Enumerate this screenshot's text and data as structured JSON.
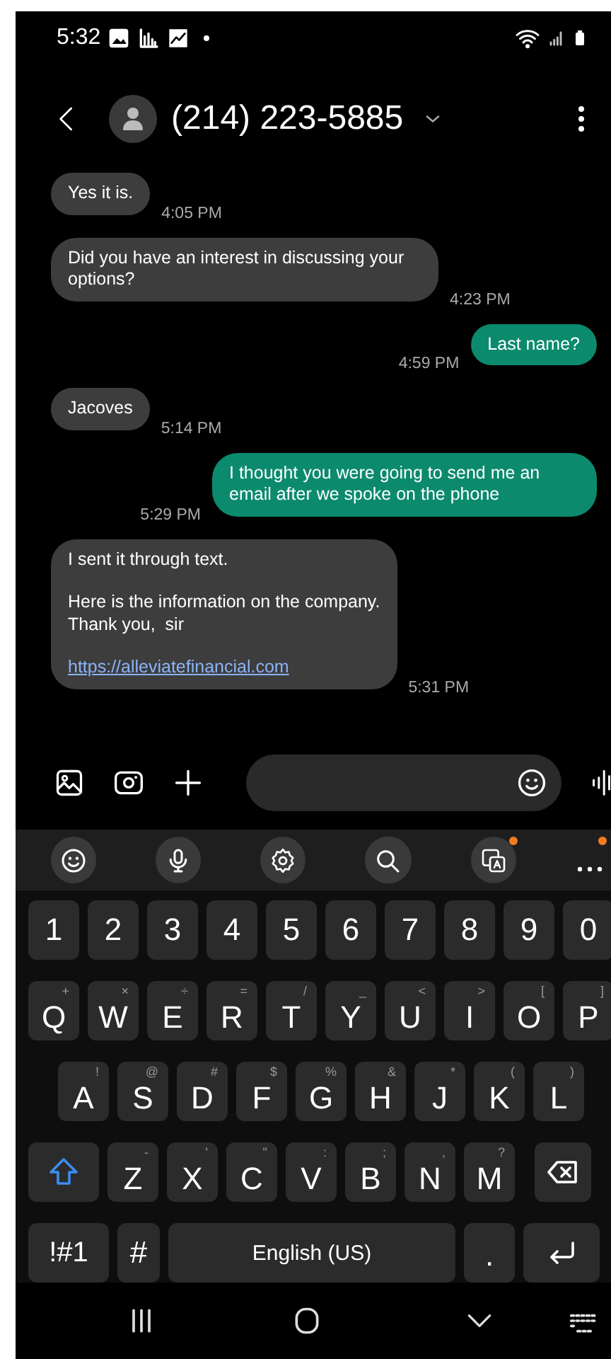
{
  "status_bar": {
    "time": "5:32"
  },
  "header": {
    "title": "(214) 223-5885"
  },
  "messages": [
    {
      "kind": "received",
      "paragraphs": [
        "Yes it is."
      ],
      "time": "4:05 PM"
    },
    {
      "kind": "received",
      "paragraphs": [
        "Did you have an interest in discussing your options?"
      ],
      "time": "4:23 PM"
    },
    {
      "kind": "sent",
      "paragraphs": [
        "Last name?"
      ],
      "time": "4:59 PM"
    },
    {
      "kind": "received",
      "paragraphs": [
        "Jacoves"
      ],
      "time": "5:14 PM"
    },
    {
      "kind": "sent",
      "paragraphs": [
        "I thought you were going to send me an email after we spoke on the phone"
      ],
      "time": "5:29 PM"
    },
    {
      "kind": "received",
      "paragraphs": [
        "I sent it through text.",
        "Here is the information on the company.\nThank you,  sir"
      ],
      "link": "https://alleviatefinancial.com",
      "time": "5:31 PM"
    }
  ],
  "keyboard": {
    "toolbar": [
      {
        "kind": "emoji",
        "badge": false
      },
      {
        "kind": "mic",
        "badge": false
      },
      {
        "kind": "settings",
        "badge": false
      },
      {
        "kind": "search",
        "badge": false
      },
      {
        "kind": "translate",
        "badge": true
      },
      {
        "kind": "more",
        "badge": true
      }
    ],
    "number_row": [
      {
        "kind": "char",
        "label": "1"
      },
      {
        "kind": "char",
        "label": "2"
      },
      {
        "kind": "char",
        "label": "3"
      },
      {
        "kind": "char",
        "label": "4"
      },
      {
        "kind": "char",
        "label": "5"
      },
      {
        "kind": "char",
        "label": "6"
      },
      {
        "kind": "char",
        "label": "7"
      },
      {
        "kind": "char",
        "label": "8"
      },
      {
        "kind": "char",
        "label": "9"
      },
      {
        "kind": "char",
        "label": "0"
      }
    ],
    "top_row": [
      {
        "kind": "char",
        "label": "Q",
        "hint": "+"
      },
      {
        "kind": "char",
        "label": "W",
        "hint": "×"
      },
      {
        "kind": "char",
        "label": "E",
        "hint": "÷"
      },
      {
        "kind": "char",
        "label": "R",
        "hint": "="
      },
      {
        "kind": "char",
        "label": "T",
        "hint": "/"
      },
      {
        "kind": "char",
        "label": "Y",
        "hint": "_"
      },
      {
        "kind": "char",
        "label": "U",
        "hint": "<"
      },
      {
        "kind": "char",
        "label": "I",
        "hint": ">"
      },
      {
        "kind": "char",
        "label": "O",
        "hint": "["
      },
      {
        "kind": "char",
        "label": "P",
        "hint": "]"
      }
    ],
    "home_row": [
      {
        "kind": "char",
        "label": "A",
        "hint": "!"
      },
      {
        "kind": "char",
        "label": "S",
        "hint": "@"
      },
      {
        "kind": "char",
        "label": "D",
        "hint": "#"
      },
      {
        "kind": "char",
        "label": "F",
        "hint": "$"
      },
      {
        "kind": "char",
        "label": "G",
        "hint": "%"
      },
      {
        "kind": "char",
        "label": "H",
        "hint": "&"
      },
      {
        "kind": "char",
        "label": "J",
        "hint": "*"
      },
      {
        "kind": "char",
        "label": "K",
        "hint": "("
      },
      {
        "kind": "char",
        "label": "L",
        "hint": ")"
      }
    ],
    "bottom_row": [
      {
        "kind": "shift"
      },
      {
        "kind": "char",
        "label": "Z",
        "hint": "-"
      },
      {
        "kind": "char",
        "label": "X",
        "hint": "'"
      },
      {
        "kind": "char",
        "label": "C",
        "hint": "\""
      },
      {
        "kind": "char",
        "label": "V",
        "hint": ":"
      },
      {
        "kind": "char",
        "label": "B",
        "hint": ";"
      },
      {
        "kind": "char",
        "label": "N",
        "hint": ","
      },
      {
        "kind": "char",
        "label": "M",
        "hint": "?"
      },
      {
        "kind": "backspace"
      }
    ],
    "space_row": [
      {
        "kind": "symbols",
        "label": "!#1"
      },
      {
        "kind": "char",
        "label": "#"
      },
      {
        "kind": "space",
        "label": "English (US)"
      },
      {
        "kind": "period",
        "label": "."
      },
      {
        "kind": "enter"
      }
    ]
  }
}
